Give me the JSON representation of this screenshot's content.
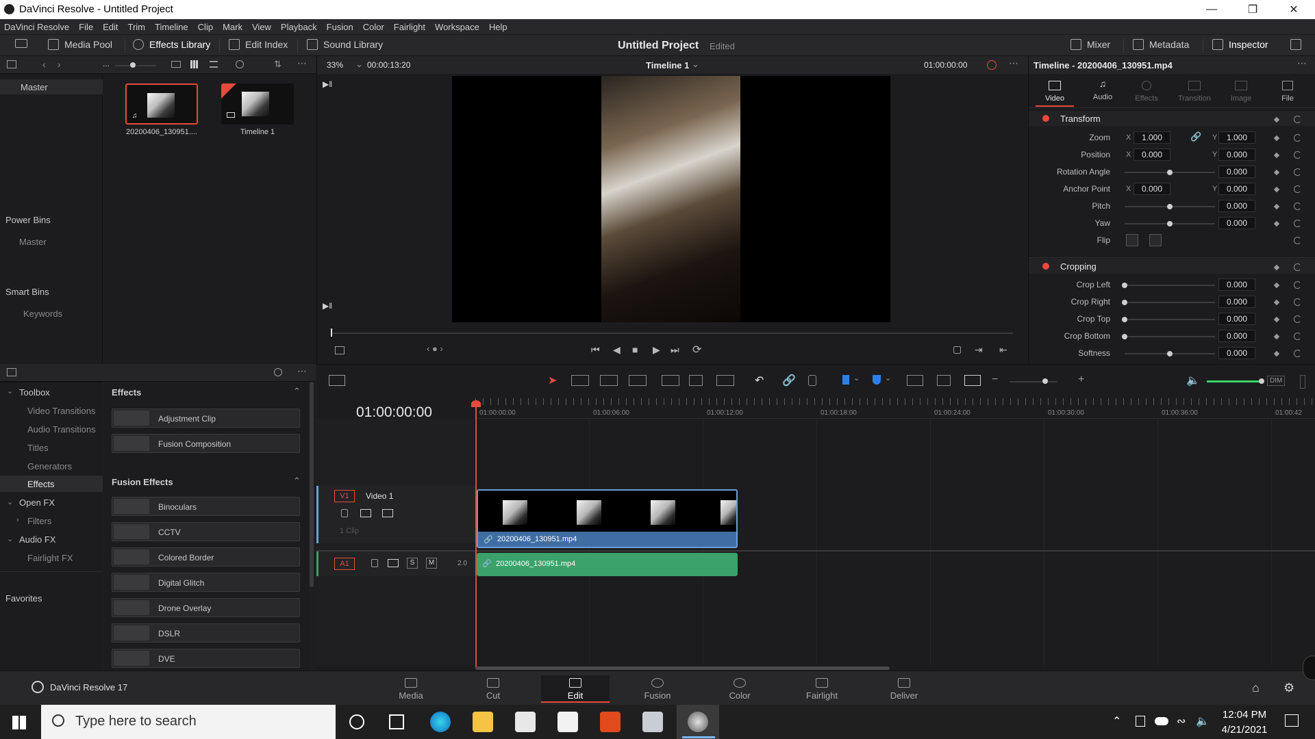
{
  "window": {
    "title": "DaVinci Resolve - Untitled Project"
  },
  "menu": [
    "DaVinci Resolve",
    "File",
    "Edit",
    "Trim",
    "Timeline",
    "Clip",
    "Mark",
    "View",
    "Playback",
    "Fusion",
    "Color",
    "Fairlight",
    "Workspace",
    "Help"
  ],
  "toolbar": {
    "media_pool": "Media Pool",
    "effects_library": "Effects Library",
    "edit_index": "Edit Index",
    "sound_library": "Sound Library",
    "project_name": "Untitled Project",
    "project_status": "Edited",
    "mixer": "Mixer",
    "metadata": "Metadata",
    "inspector": "Inspector"
  },
  "viewer": {
    "zoom": "33%",
    "duration": "00:00:13:20",
    "timeline_name": "Timeline 1",
    "timecode": "01:00:00:00",
    "playhead_fraction": 0.0
  },
  "bins": {
    "master": "Master",
    "power_bins": "Power Bins",
    "power_master": "Master",
    "smart_bins": "Smart Bins",
    "keywords": "Keywords"
  },
  "media": [
    {
      "name": "20200406_130951...."
    },
    {
      "name": "Timeline 1"
    }
  ],
  "inspector": {
    "title": "Timeline - 20200406_130951.mp4",
    "tabs": [
      "Video",
      "Audio",
      "Effects",
      "Transition",
      "Image",
      "File"
    ],
    "transform": {
      "header": "Transform",
      "zoom_label": "Zoom",
      "zoom_x": "1.000",
      "zoom_y": "1.000",
      "position_label": "Position",
      "position_x": "0.000",
      "position_y": "0.000",
      "rotation_label": "Rotation Angle",
      "rotation": "0.000",
      "anchor_label": "Anchor Point",
      "anchor_x": "0.000",
      "anchor_y": "0.000",
      "pitch_label": "Pitch",
      "pitch": "0.000",
      "yaw_label": "Yaw",
      "yaw": "0.000",
      "flip_label": "Flip"
    },
    "cropping": {
      "header": "Cropping",
      "left_label": "Crop Left",
      "left": "0.000",
      "right_label": "Crop Right",
      "right": "0.000",
      "top_label": "Crop Top",
      "top": "0.000",
      "bottom_label": "Crop Bottom",
      "bottom": "0.000",
      "softness_label": "Softness",
      "softness": "0.000"
    },
    "x_label": "X",
    "y_label": "Y"
  },
  "toolbox": {
    "toolbox": "Toolbox",
    "video_transitions": "Video Transitions",
    "audio_transitions": "Audio Transitions",
    "titles": "Titles",
    "generators": "Generators",
    "effects": "Effects",
    "open_fx": "Open FX",
    "filters": "Filters",
    "audio_fx": "Audio FX",
    "fairlight_fx": "Fairlight FX",
    "favorites": "Favorites"
  },
  "effects_panel": {
    "effects_header": "Effects",
    "effects": [
      "Adjustment Clip",
      "Fusion Composition"
    ],
    "fusion_header": "Fusion Effects",
    "fusion_effects": [
      "Binoculars",
      "CCTV",
      "Colored Border",
      "Digital Glitch",
      "Drone Overlay",
      "DSLR",
      "DVE"
    ]
  },
  "timeline": {
    "timecode": "01:00:00:00",
    "ruler": [
      "01:00:00:00",
      "01:00:06:00",
      "01:00:12:00",
      "01:00:18:00",
      "01:00:24:00",
      "01:00:30:00",
      "01:00:36:00",
      "01:00:42"
    ],
    "video_track": {
      "id": "V1",
      "name": "Video 1",
      "clips": "1 Clip"
    },
    "audio_track": {
      "id": "A1",
      "level": "2.0",
      "solo": "S",
      "mute": "M"
    },
    "video_clip": "20200406_130951.mp4",
    "audio_clip": "20200406_130951.mp4",
    "dim_label": "DIM"
  },
  "pages": [
    "Media",
    "Cut",
    "Edit",
    "Fusion",
    "Color",
    "Fairlight",
    "Deliver"
  ],
  "active_page": "Edit",
  "app_version": "DaVinci Resolve 17",
  "taskbar": {
    "search_placeholder": "Type here to search",
    "time": "12:04 PM",
    "date": "4/21/2021"
  },
  "colors": {
    "accent_red": "#e64b3c",
    "clip_video": "#3e6ea3",
    "clip_audio": "#3aa26a"
  }
}
